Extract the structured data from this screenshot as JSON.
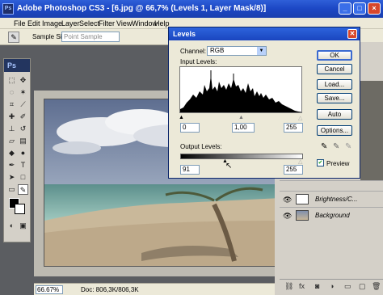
{
  "window": {
    "title": "Adobe Photoshop CS3 - [6.jpg @ 66,7% (Levels 1, Layer Mask/8)]",
    "app_icon": "Ps"
  },
  "menu": [
    "File",
    "Edit",
    "Image",
    "Layer",
    "Select",
    "Filter",
    "View",
    "Window",
    "Help"
  ],
  "options_bar": {
    "sample_size_label": "Sample Size:",
    "sample_size_value": "Point Sample"
  },
  "tools_panel": {
    "logo": "Ps"
  },
  "status": {
    "zoom": "66.67%",
    "doc": "Doc: 806,3K/806,3K"
  },
  "levels_dialog": {
    "title": "Levels",
    "channel_label": "Channel:",
    "channel_value": "RGB",
    "input_levels_label": "Input Levels:",
    "input_black": "0",
    "input_gamma": "1,00",
    "input_white": "255",
    "output_levels_label": "Output Levels:",
    "output_black": "91",
    "output_white": "255",
    "buttons": [
      "OK",
      "Cancel",
      "Load...",
      "Save...",
      "Auto",
      "Options..."
    ],
    "preview_label": "Preview",
    "preview_checked": true
  },
  "layers": [
    {
      "name": "Brightness/C...",
      "visible": true
    },
    {
      "name": "Background",
      "visible": true
    }
  ],
  "colors": {
    "titlebar": "#1c47c4",
    "menu_bg": "#ece9d8",
    "selected_layer": "#3165c6"
  }
}
